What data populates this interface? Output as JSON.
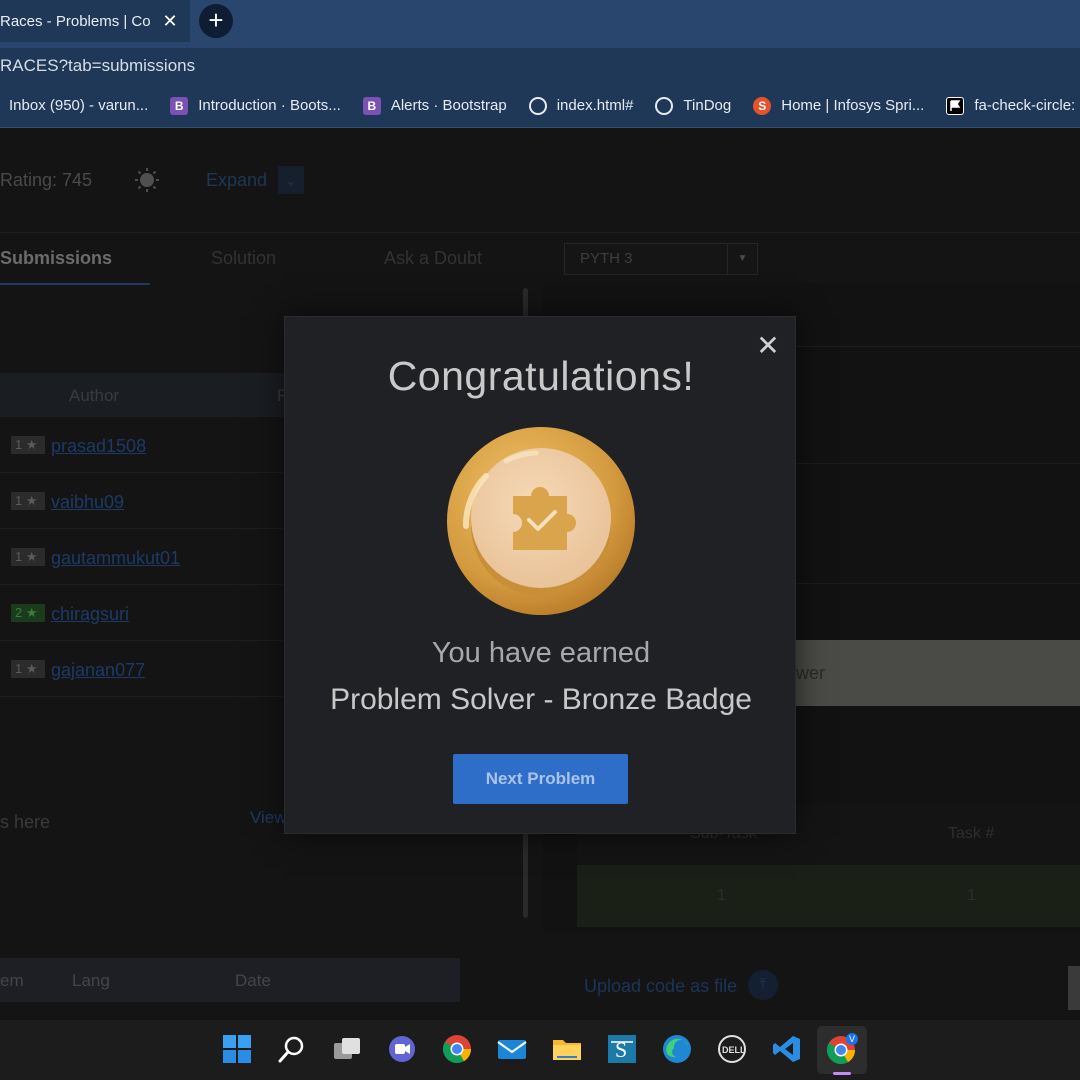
{
  "browser": {
    "tab_title": "Races - Problems | CodeChef",
    "close_symbol": "✕",
    "new_tab_symbol": "+",
    "address": "RACES?tab=submissions"
  },
  "bookmarks": [
    {
      "label": "Inbox (950) - varun...",
      "icon": "gmail-icon"
    },
    {
      "label": "Introduction · Boots...",
      "icon": "bootstrap-icon",
      "glyph": "B"
    },
    {
      "label": "Alerts · Bootstrap",
      "icon": "bootstrap-icon",
      "glyph": "B"
    },
    {
      "label": "index.html#",
      "icon": "globe-icon"
    },
    {
      "label": "TinDog",
      "icon": "globe-icon"
    },
    {
      "label": "Home | Infosys Spri...",
      "icon": "infosys-icon",
      "glyph": "S"
    },
    {
      "label": "fa-check-circle: F",
      "icon": "flag-icon"
    }
  ],
  "page": {
    "rating": "Rating: 745",
    "expand": "Expand",
    "tabs": [
      "Submissions",
      "Solution",
      "Ask a Doubt"
    ],
    "language": "PYTH 3",
    "table_header": {
      "author": "Author",
      "r": "R"
    },
    "rows": [
      {
        "stars": "1 ★",
        "author": "prasad1508",
        "green": false
      },
      {
        "stars": "1 ★",
        "author": "vaibhu09",
        "green": false
      },
      {
        "stars": "1 ★",
        "author": "gautammukut01",
        "green": false
      },
      {
        "stars": "2 ★",
        "author": "chiragsuri",
        "green": true
      },
      {
        "stars": "1 ★",
        "author": "gajanan077",
        "green": false
      }
    ],
    "here_text": "s here",
    "view_text": "View",
    "submission_header": {
      "col1": "em",
      "col2": "Lang",
      "col3": "Date"
    },
    "answer_text": "wer",
    "task_header": {
      "subtask": "Sub-Task",
      "task": "Task #"
    },
    "task_row": {
      "subtask": "1",
      "task": "1"
    },
    "upload": "Upload code as file"
  },
  "modal": {
    "close_symbol": "✕",
    "title": "Congratulations!",
    "earned": "You have earned",
    "badge_name": "Problem Solver - Bronze Badge",
    "button": "Next Problem"
  },
  "taskbar": {
    "apps": [
      "windows-start-icon",
      "search-icon",
      "task-view-icon",
      "teams-chat-icon",
      "chrome-icon",
      "mail-icon",
      "file-explorer-icon",
      "sway-icon",
      "edge-icon",
      "dell-icon",
      "vscode-icon",
      "chrome-profile-icon"
    ],
    "profile_initial": "V"
  },
  "colors": {
    "accent_button": "#2f6ec8",
    "modal_bg": "#202124",
    "browser_frame": "#28466e",
    "medal_gold": "#d9a44c"
  }
}
